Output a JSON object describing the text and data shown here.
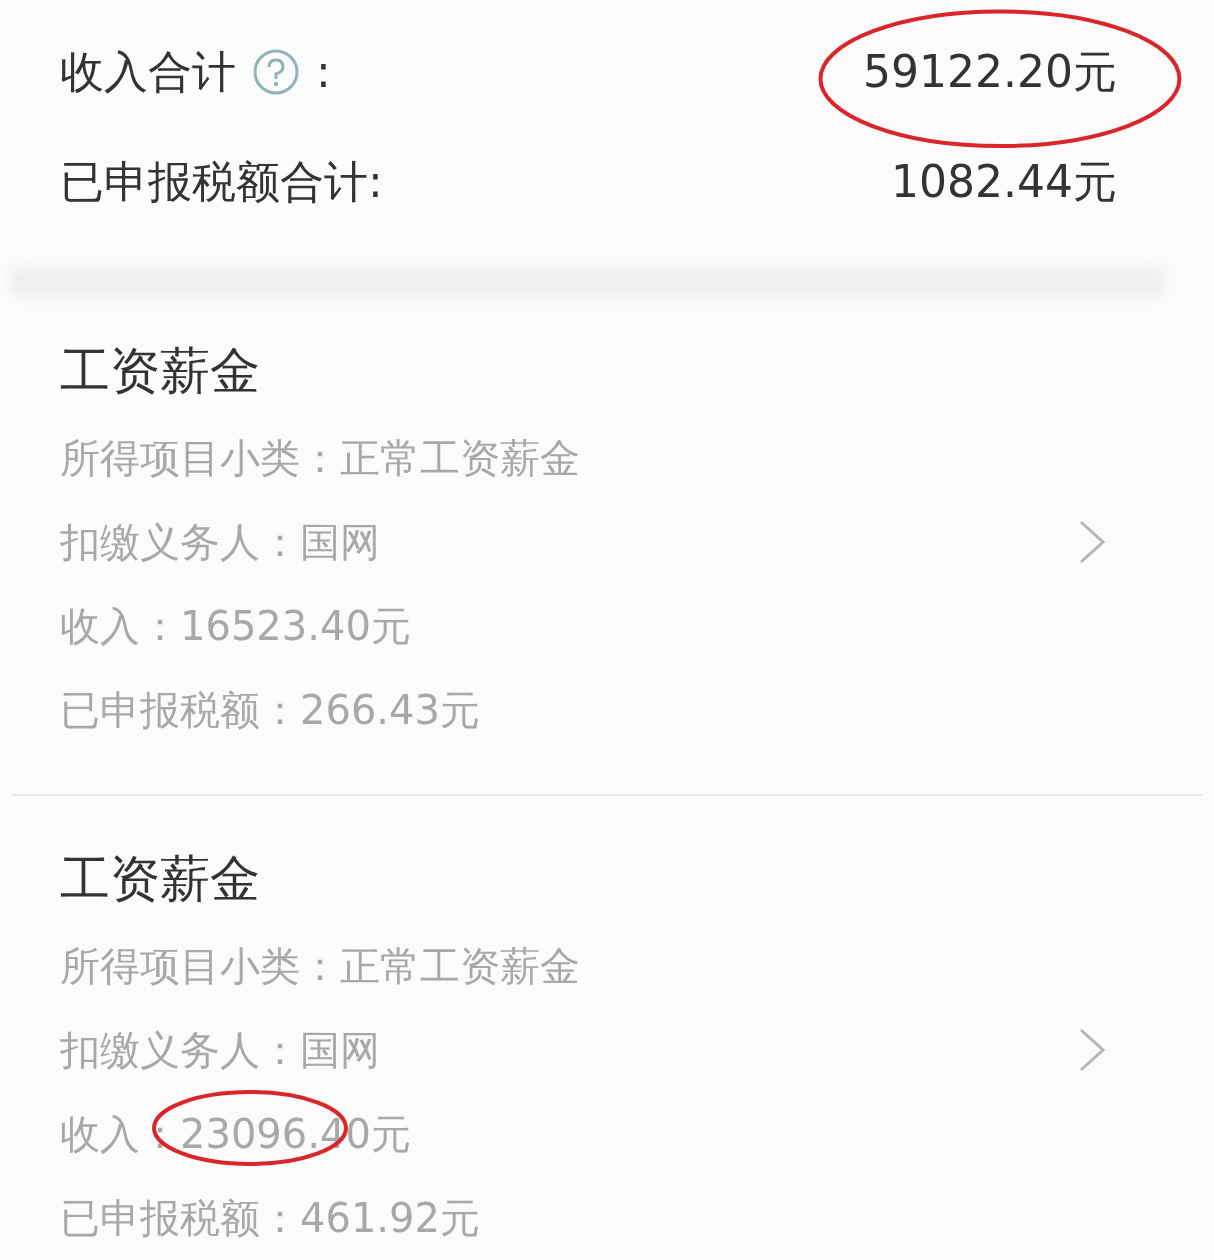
{
  "summary": [
    {
      "label": "收入合计",
      "help": true,
      "colon": ":",
      "value": "59122.20元",
      "circled": true
    },
    {
      "label": "已申报税额合计:",
      "help": false,
      "value": "1082.44元",
      "circled": false
    }
  ],
  "sections": [
    {
      "title": "工资薪金",
      "rows": [
        {
          "kind": "plain",
          "label": "所得项目小类：",
          "value": "正常工资薪金",
          "circled": false
        },
        {
          "kind": "link",
          "label": "扣缴义务人：",
          "value": "国网",
          "circled": false
        },
        {
          "kind": "plain",
          "label": "收入：",
          "value": "16523.40元",
          "circled": false
        },
        {
          "kind": "plain",
          "label": "已申报税额：",
          "value": "266.43元",
          "circled": false
        }
      ]
    },
    {
      "title": "工资薪金",
      "rows": [
        {
          "kind": "plain",
          "label": "所得项目小类：",
          "value": "正常工资薪金",
          "circled": false
        },
        {
          "kind": "link",
          "label": "扣缴义务人：",
          "value": "国网",
          "circled": false
        },
        {
          "kind": "plain",
          "label": "收入：",
          "value": "23096.40元",
          "circled": true
        },
        {
          "kind": "plain",
          "label": "已申报税额：",
          "value": "461.92元",
          "circled": false
        }
      ]
    }
  ]
}
